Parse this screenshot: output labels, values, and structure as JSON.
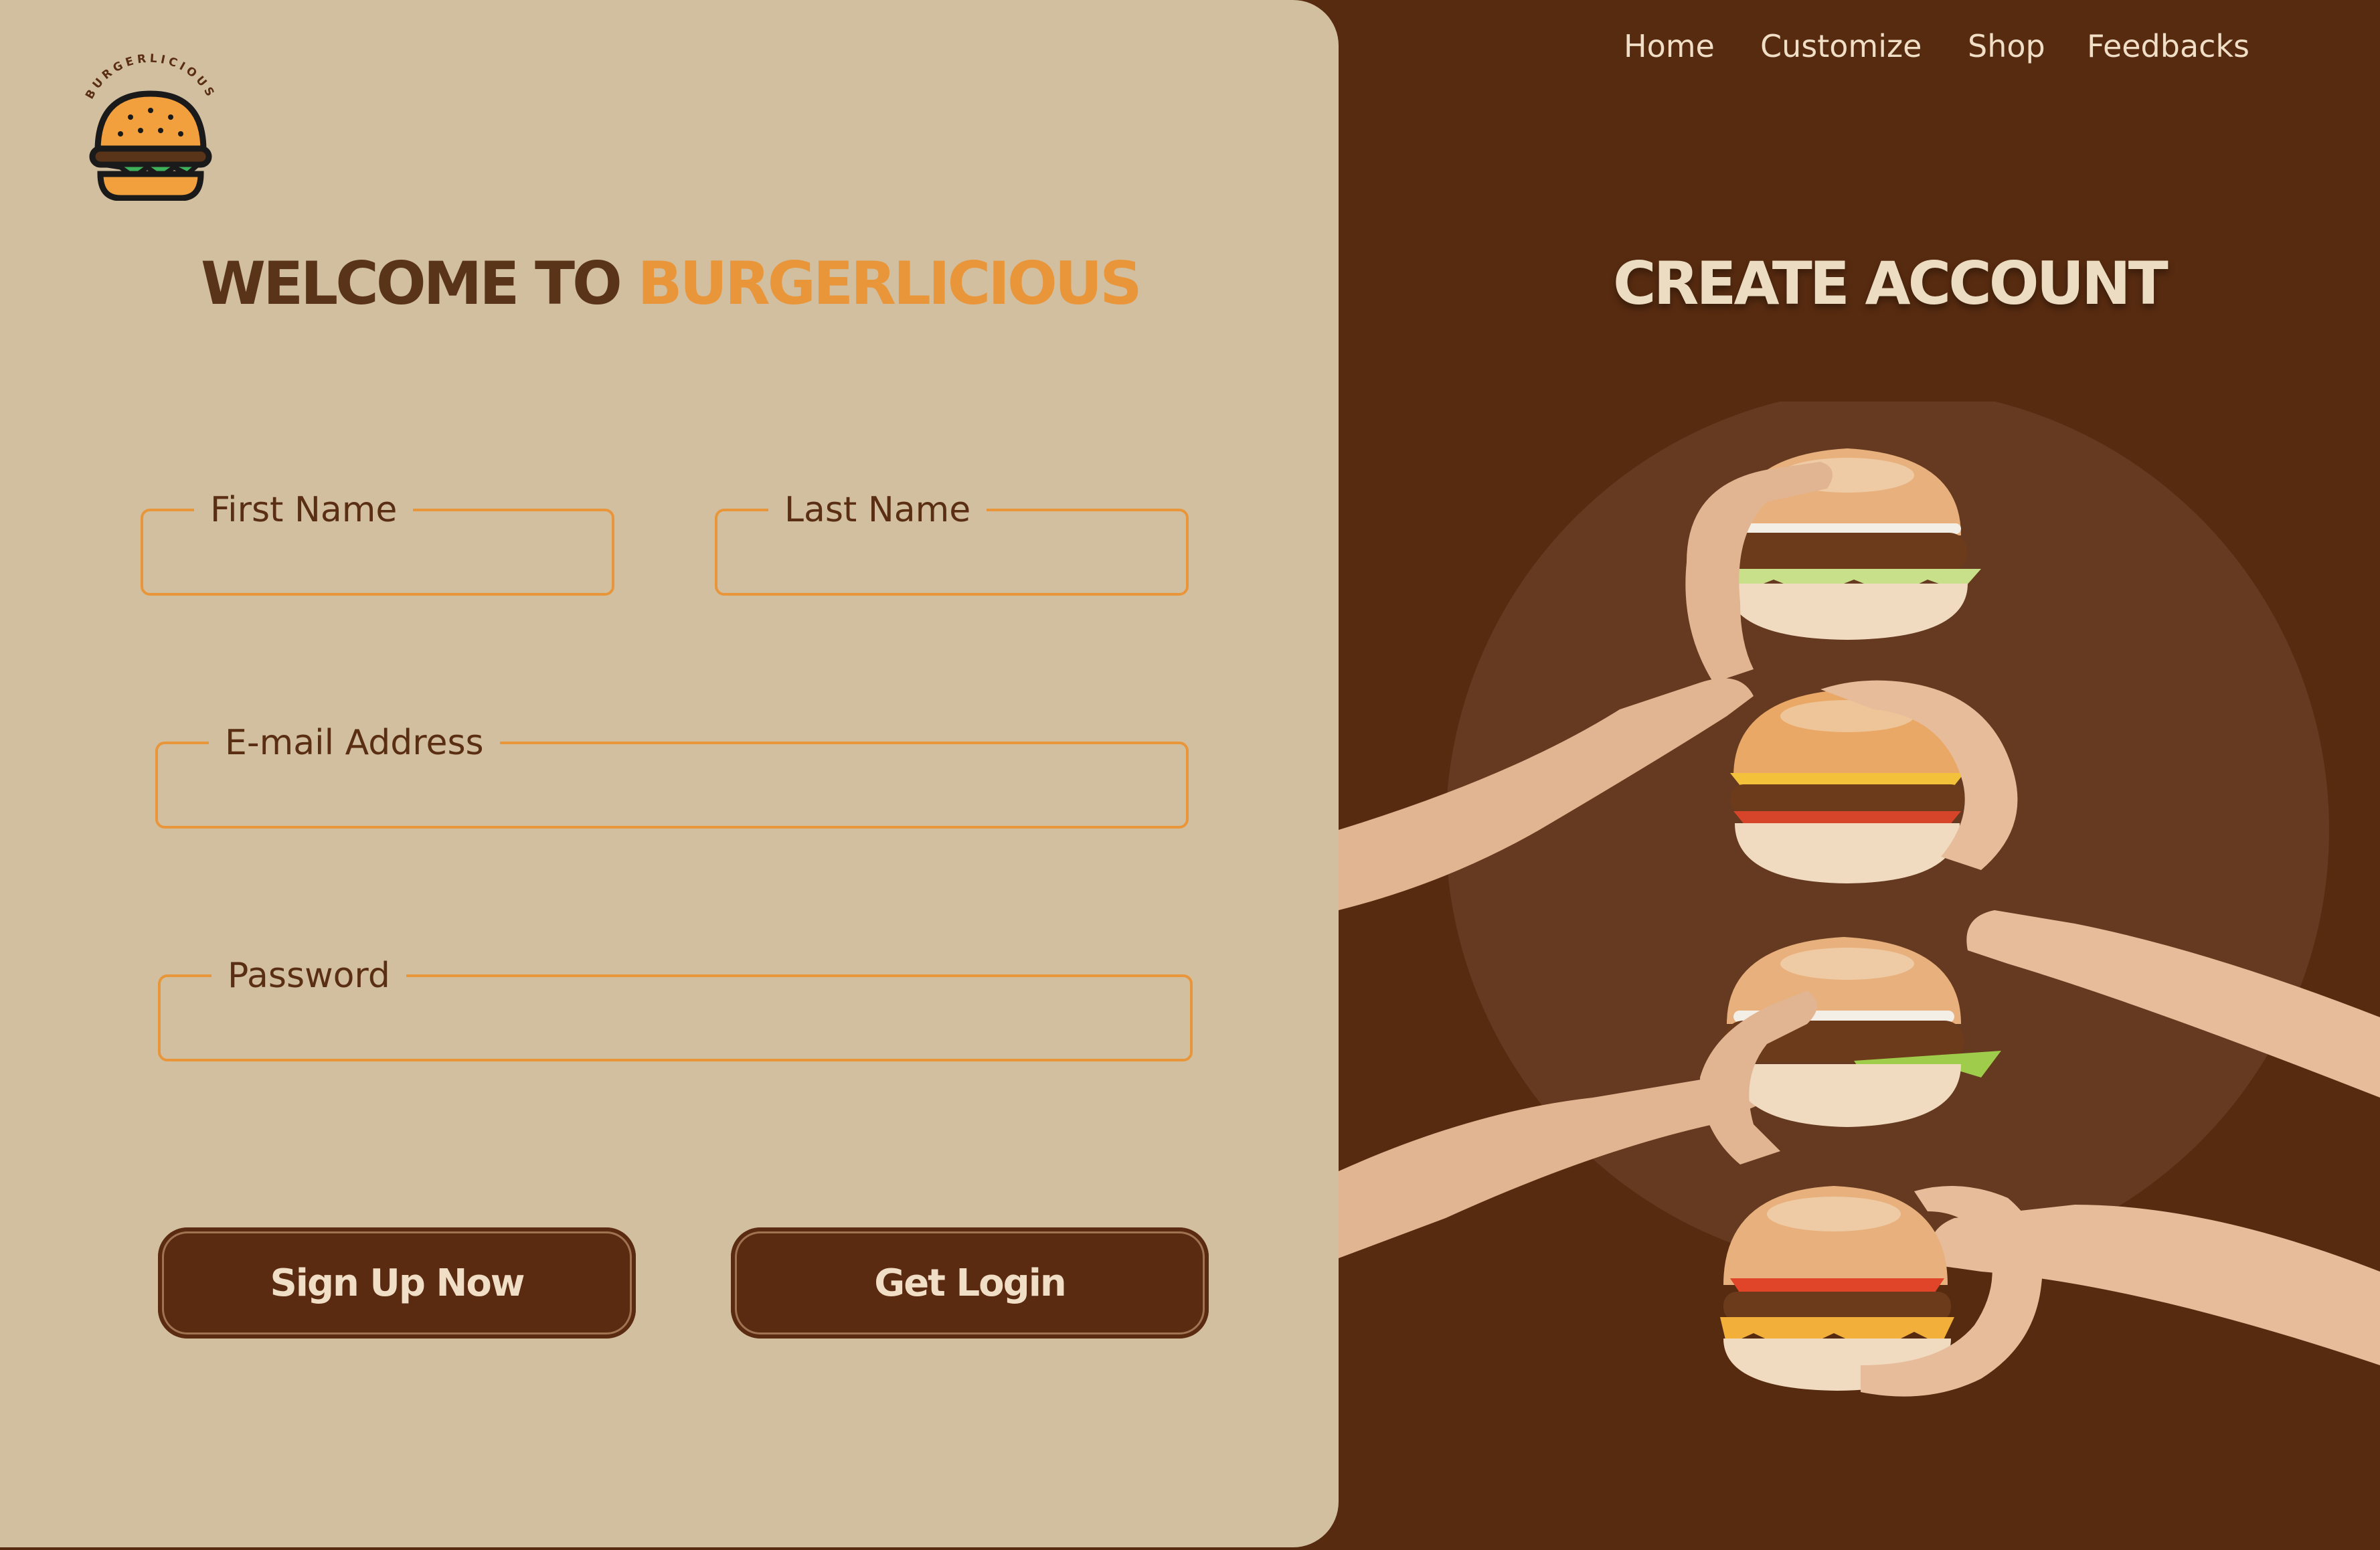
{
  "brand": {
    "logo_text": "BURGERLICIOUS",
    "welcome_prefix": "WELCOME TO",
    "welcome_brand": "BURGERLICIOUS"
  },
  "nav": {
    "items": [
      {
        "label": "Home"
      },
      {
        "label": "Customize"
      },
      {
        "label": "Shop"
      },
      {
        "label": "Feedbacks"
      }
    ]
  },
  "form": {
    "first_name_label": "First Name",
    "last_name_label": "Last Name",
    "email_label": "E-mail Address",
    "password_label": "Password",
    "first_name_value": "",
    "last_name_value": "",
    "email_value": "",
    "password_value": ""
  },
  "buttons": {
    "signup_label": "Sign Up Now",
    "login_label": "Get Login"
  },
  "hero": {
    "title": "CREATE ACCOUNT"
  },
  "colors": {
    "background_dark": "#572b10",
    "panel_light": "#d2bf9f",
    "accent_orange": "#e9963a",
    "text_brown": "#5a2e12",
    "light_text": "#f0dfc6"
  }
}
